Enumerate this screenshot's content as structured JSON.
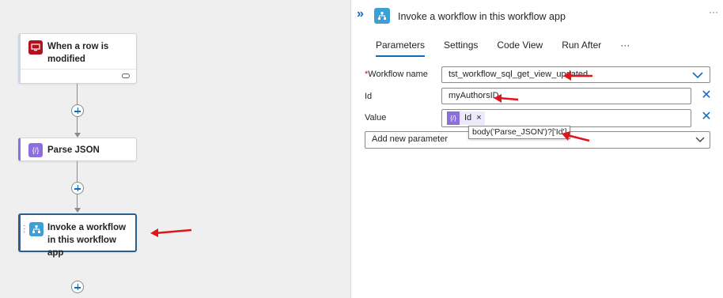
{
  "canvas": {
    "trigger": {
      "title": "When a row is modified"
    },
    "parse": {
      "title": "Parse JSON"
    },
    "invoke": {
      "title": "Invoke a workflow in this workflow app"
    }
  },
  "panel": {
    "header_title": "Invoke a workflow in this workflow app",
    "expand_glyph": "»",
    "more_glyph": "···",
    "tabs": [
      "Parameters",
      "Settings",
      "Code View",
      "Run After",
      "···"
    ],
    "workflow_name": {
      "label": "Workflow name",
      "required_mark": "*",
      "value": "tst_workflow_sql_get_view_updated"
    },
    "id": {
      "label": "Id",
      "value": "myAuthorsID"
    },
    "value": {
      "label": "Value",
      "token": "Id",
      "tooltip": "body('Parse_JSON')?['Id']"
    },
    "add_parameter": {
      "placeholder": "Add new parameter"
    }
  },
  "colors": {
    "accent": "#0f6cbd",
    "arrow_red": "#e0151b",
    "trigger_red": "#b3111d",
    "parse_purple": "#8c6ee0",
    "invoke_blue": "#3d9fd6"
  }
}
